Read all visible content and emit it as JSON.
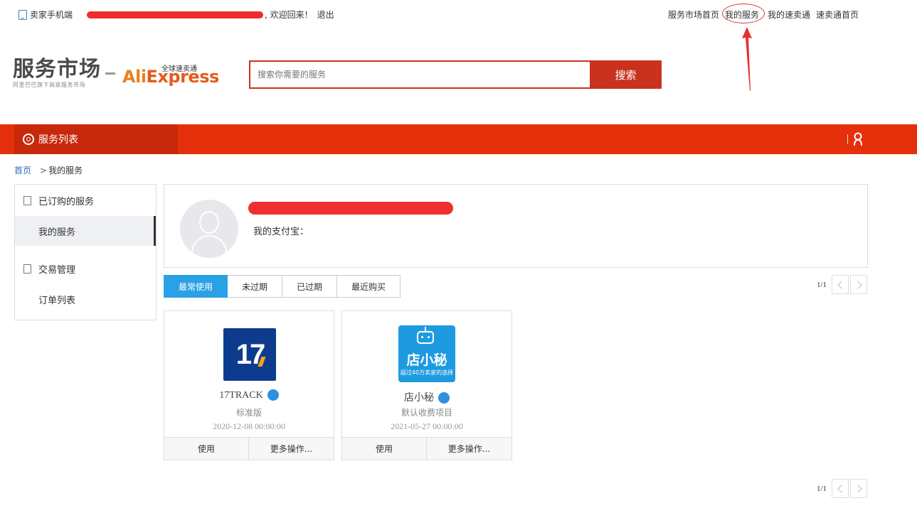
{
  "topbar": {
    "mobile_label": "卖家手机端",
    "welcome": ", 欢迎回来！",
    "logout": "退出",
    "links": [
      "服务市场首页",
      "我的服务",
      "我的速卖通",
      "速卖通首页"
    ]
  },
  "header": {
    "logo_main": "服务市场",
    "logo_sub": "阿里巴巴旗下商家服务市场",
    "brand_cn": "全球速卖通",
    "brand_en_a": "Ali",
    "brand_en_b": "Express",
    "search_placeholder": "搜索你需要的服务",
    "search_button": "搜索"
  },
  "nav": {
    "service_list": "服务列表"
  },
  "breadcrumb": {
    "home": "首页",
    "sep": ">",
    "current": "我的服务"
  },
  "sidebar": {
    "section1": "已订购的服务",
    "item1": "我的服务",
    "section2": "交易管理",
    "item2": "订单列表"
  },
  "profile": {
    "alipay_label": "我的支付宝："
  },
  "tabs": [
    "最常使用",
    "未过期",
    "已过期",
    "最近购买"
  ],
  "pager": {
    "text": "1/1"
  },
  "cards": [
    {
      "icon_text": "17",
      "title": "17TRACK",
      "subtitle": "标准版",
      "date": "2020-12-08 00:00:00",
      "use": "使用",
      "more": "更多操作..."
    },
    {
      "icon_text": "店小秘",
      "icon_tag": "超过40万卖家的选择",
      "title": "店小秘",
      "subtitle": "默认收费项目",
      "date": "2021-05-27 00:00:00",
      "use": "使用",
      "more": "更多操作..."
    }
  ],
  "colors": {
    "brand_red": "#e5300b",
    "tab_active": "#29a1e6",
    "link_blue": "#2a6fb7"
  }
}
